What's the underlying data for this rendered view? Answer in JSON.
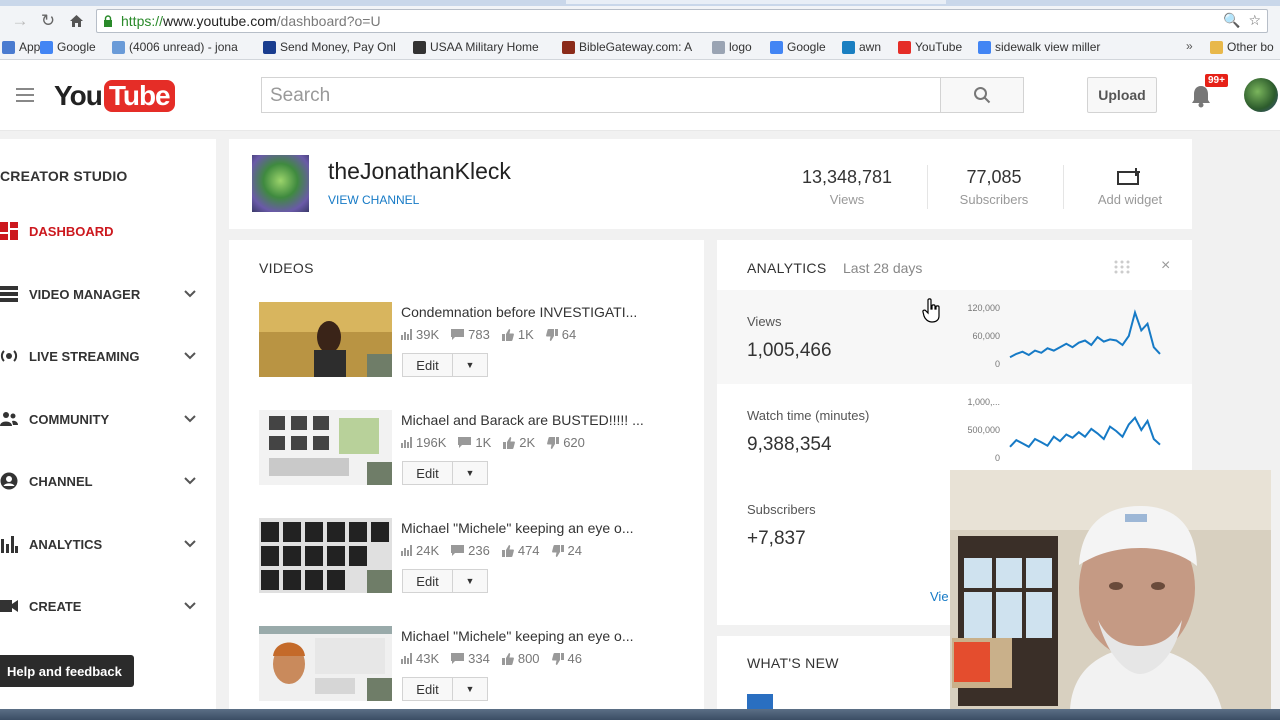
{
  "browser": {
    "url_scheme": "https://",
    "url_host": "www.youtube.com",
    "url_path": "/dashboard?o=U",
    "bookmarks": [
      {
        "label": "Apps",
        "icon": "apps-grid-icon",
        "color": "#4a7bd0"
      },
      {
        "label": "Google",
        "icon": "google-icon",
        "color": "#4285f4"
      },
      {
        "label": "(4006 unread) - jona",
        "icon": "mail-icon",
        "color": "#6a9bd8"
      },
      {
        "label": "Send Money, Pay Onl",
        "icon": "paypal-icon",
        "color": "#1a3d8f"
      },
      {
        "label": "USAA Military Home",
        "icon": "usaa-icon",
        "color": "#333333"
      },
      {
        "label": "BibleGateway.com: A",
        "icon": "biblegateway-icon",
        "color": "#8b2b1a"
      },
      {
        "label": "logo",
        "icon": "logo-icon",
        "color": "#9aa4b3"
      },
      {
        "label": "Google",
        "icon": "google-icon",
        "color": "#4285f4"
      },
      {
        "label": "awn",
        "icon": "awn-icon",
        "color": "#1a7fc1"
      },
      {
        "label": "YouTube",
        "icon": "youtube-icon",
        "color": "#e52d27"
      },
      {
        "label": "sidewalk view miller",
        "icon": "google-icon",
        "color": "#4285f4"
      }
    ],
    "other_bookmarks": "Other bo"
  },
  "header": {
    "logo_you": "You",
    "logo_tube": "Tube",
    "search_placeholder": "Search",
    "upload_label": "Upload",
    "notification_count": "99+"
  },
  "sidebar": {
    "title": "CREATOR STUDIO",
    "items": [
      {
        "label": "DASHBOARD",
        "icon": "dashboard-icon",
        "active": true,
        "chevron": false
      },
      {
        "label": "VIDEO MANAGER",
        "icon": "video-manager-icon",
        "active": false,
        "chevron": true
      },
      {
        "label": "LIVE STREAMING",
        "icon": "live-streaming-icon",
        "active": false,
        "chevron": true
      },
      {
        "label": "COMMUNITY",
        "icon": "community-icon",
        "active": false,
        "chevron": true
      },
      {
        "label": "CHANNEL",
        "icon": "channel-icon",
        "active": false,
        "chevron": true
      },
      {
        "label": "ANALYTICS",
        "icon": "analytics-icon",
        "active": false,
        "chevron": true
      },
      {
        "label": "CREATE",
        "icon": "create-icon",
        "active": false,
        "chevron": true
      }
    ],
    "help_label": "Help and feedback"
  },
  "channel": {
    "name": "theJonathanKleck",
    "view_link": "VIEW CHANNEL",
    "views_value": "13,348,781",
    "views_label": "Views",
    "subscribers_value": "77,085",
    "subscribers_label": "Subscribers",
    "add_widget_label": "Add widget"
  },
  "videos": {
    "title": "VIDEOS",
    "edit_label": "Edit",
    "items": [
      {
        "title": "Condemnation before INVESTIGATI...",
        "views": "39K",
        "comments": "783",
        "likes": "1K",
        "dislikes": "64"
      },
      {
        "title": "Michael and Barack are BUSTED!!!!! ...",
        "views": "196K",
        "comments": "1K",
        "likes": "2K",
        "dislikes": "620"
      },
      {
        "title": "Michael \"Michele\" keeping an eye o...",
        "views": "24K",
        "comments": "236",
        "likes": "474",
        "dislikes": "24"
      },
      {
        "title": "Michael \"Michele\" keeping an eye o...",
        "views": "43K",
        "comments": "334",
        "likes": "800",
        "dislikes": "46"
      }
    ]
  },
  "analytics": {
    "title": "ANALYTICS",
    "period": "Last 28 days",
    "metrics": [
      {
        "label": "Views",
        "value": "1,005,466",
        "y_ticks": [
          "120,000",
          "60,000",
          "0"
        ],
        "series": [
          0.12,
          0.18,
          0.22,
          0.16,
          0.24,
          0.2,
          0.28,
          0.24,
          0.3,
          0.36,
          0.3,
          0.38,
          0.42,
          0.34,
          0.48,
          0.4,
          0.44,
          0.42,
          0.34,
          0.5,
          0.92,
          0.6,
          0.72,
          0.3,
          0.18
        ]
      },
      {
        "label": "Watch time (minutes)",
        "value": "9,388,354",
        "y_ticks": [
          "1,000,...",
          "500,000",
          "0"
        ],
        "series": [
          0.2,
          0.32,
          0.26,
          0.2,
          0.34,
          0.28,
          0.22,
          0.38,
          0.3,
          0.42,
          0.36,
          0.46,
          0.38,
          0.52,
          0.44,
          0.34,
          0.56,
          0.48,
          0.38,
          0.6,
          0.72,
          0.5,
          0.66,
          0.34,
          0.24
        ]
      },
      {
        "label": "Subscribers",
        "value": "+7,837"
      }
    ],
    "view_more": "Vie"
  },
  "whats_new": {
    "title": "WHAT'S NEW"
  },
  "colors": {
    "brand_red": "#e52d27",
    "link_blue": "#167ac6",
    "chart_line": "#167ac6",
    "active_red": "#cc181e"
  }
}
